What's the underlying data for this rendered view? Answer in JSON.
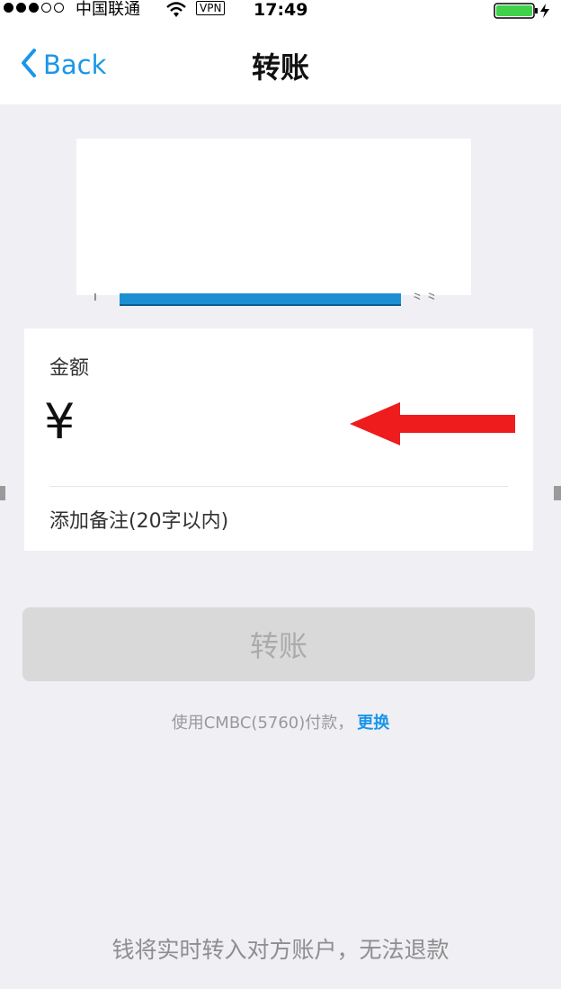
{
  "status_bar": {
    "carrier": "中国联通",
    "vpn": "VPN",
    "time": "17:49",
    "signal_bars": 5,
    "signal_filled": 3
  },
  "nav": {
    "back_label": "Back",
    "title": "转账"
  },
  "amount_panel": {
    "label": "金额",
    "currency_symbol": "¥",
    "amount_value": "",
    "remark_placeholder": "添加备注(20字以内)"
  },
  "transfer_button": {
    "label": "转账"
  },
  "payment": {
    "text": "使用CMBC(5760)付款，",
    "change_label": "更换"
  },
  "footer": {
    "note": "钱将实时转入对方账户，无法退款"
  },
  "colors": {
    "accent": "#1a96e8",
    "arrow": "#ee1c1c",
    "disabled_button": "#d9d9d9",
    "background": "#efeff4"
  }
}
